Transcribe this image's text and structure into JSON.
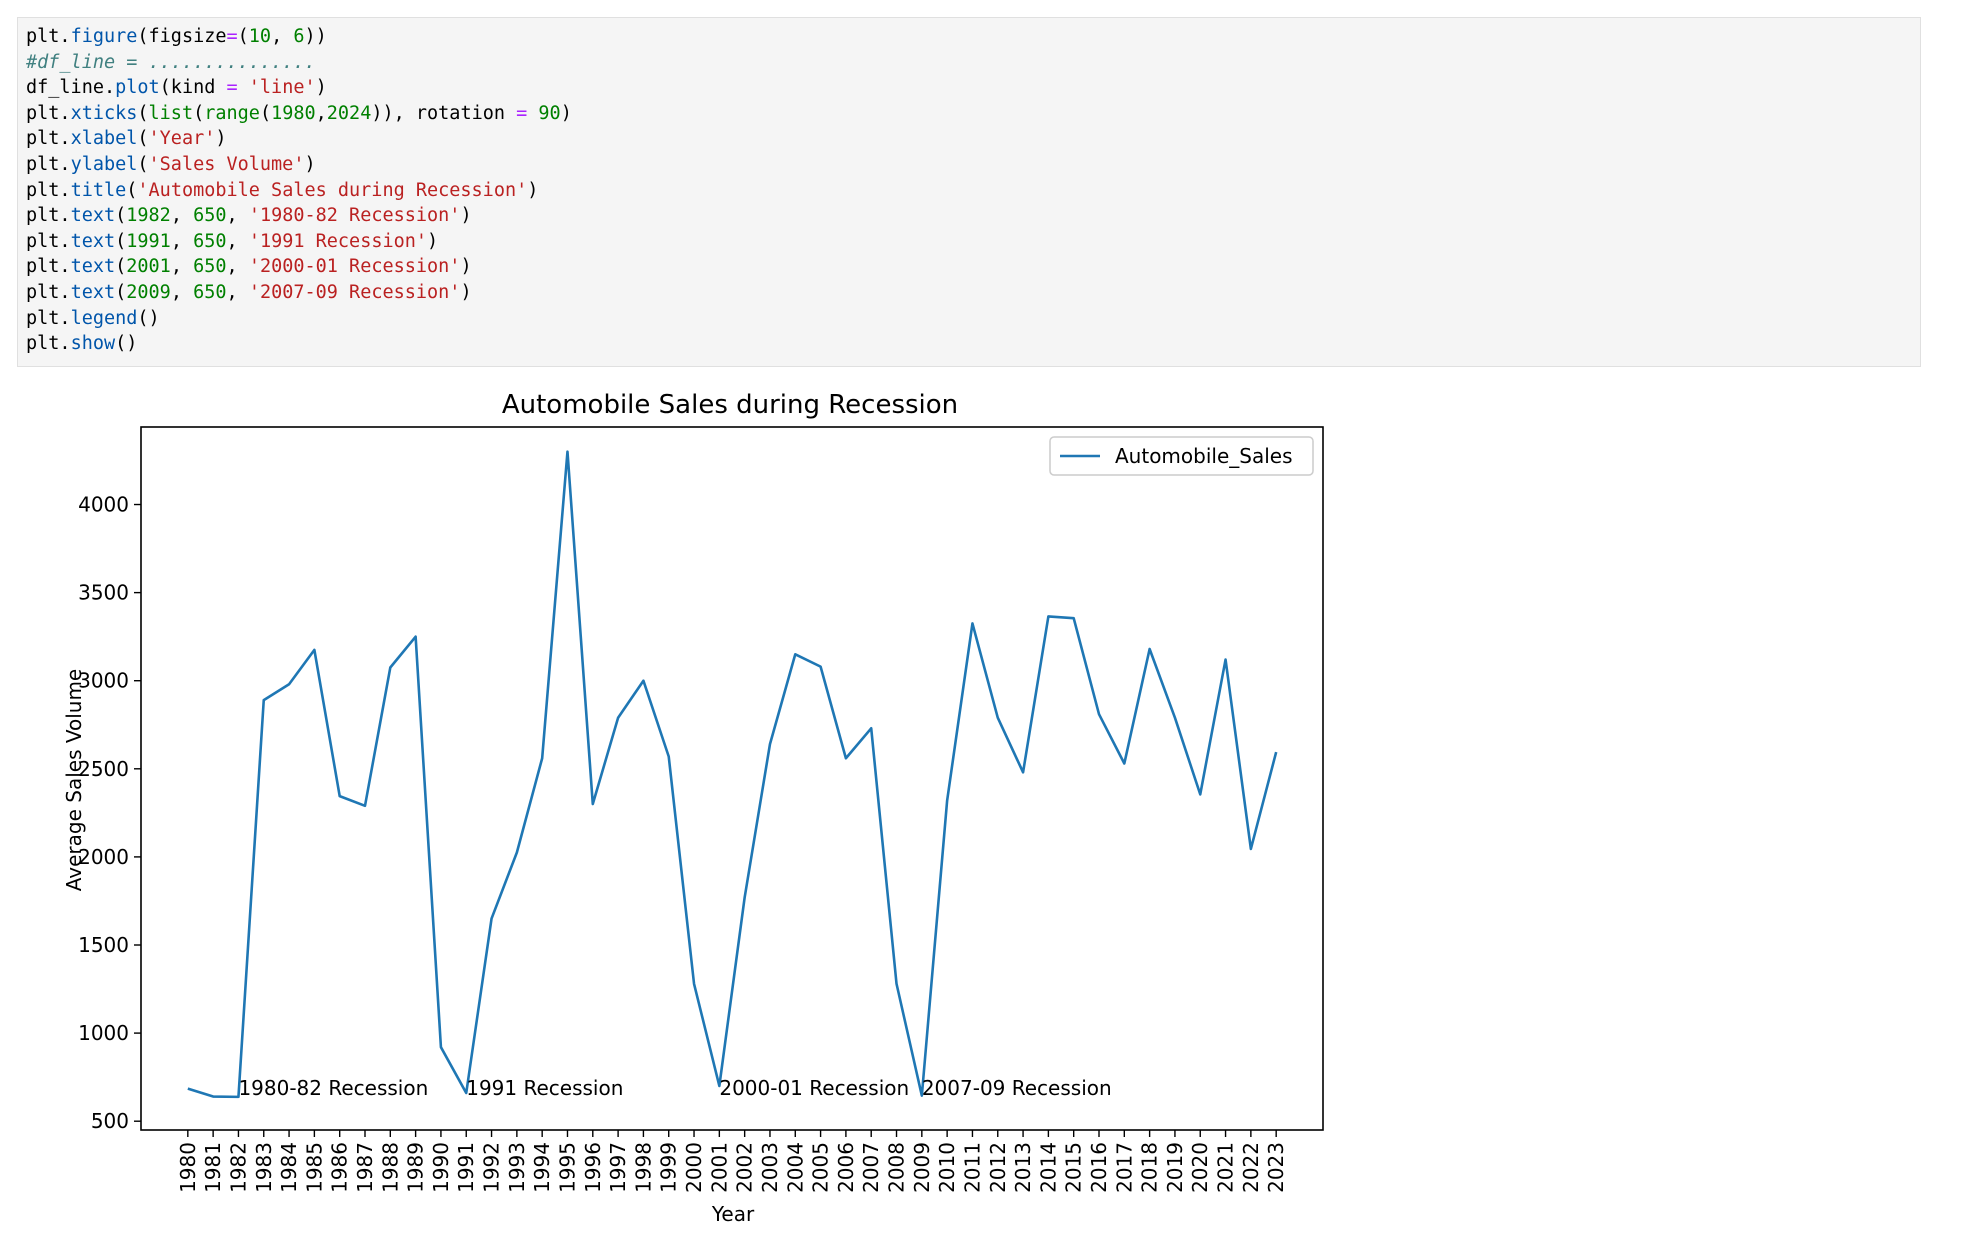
{
  "code_cell": {
    "lines": [
      [
        {
          "t": "plt.",
          "c": "plain"
        },
        {
          "t": "figure",
          "c": "fn"
        },
        {
          "t": "(figsize",
          "c": "plain"
        },
        {
          "t": "=",
          "c": "op"
        },
        {
          "t": "(",
          "c": "plain"
        },
        {
          "t": "10",
          "c": "num"
        },
        {
          "t": ", ",
          "c": "plain"
        },
        {
          "t": "6",
          "c": "num"
        },
        {
          "t": "))",
          "c": "plain"
        }
      ],
      [
        {
          "t": "#df_line = ...............",
          "c": "comment"
        }
      ],
      [
        {
          "t": "df_line.",
          "c": "plain"
        },
        {
          "t": "plot",
          "c": "fn"
        },
        {
          "t": "(kind ",
          "c": "plain"
        },
        {
          "t": "=",
          "c": "op"
        },
        {
          "t": " ",
          "c": "plain"
        },
        {
          "t": "'line'",
          "c": "str"
        },
        {
          "t": ")",
          "c": "plain"
        }
      ],
      [
        {
          "t": "plt.",
          "c": "plain"
        },
        {
          "t": "xticks",
          "c": "fn"
        },
        {
          "t": "(",
          "c": "plain"
        },
        {
          "t": "list",
          "c": "num"
        },
        {
          "t": "(",
          "c": "plain"
        },
        {
          "t": "range",
          "c": "num"
        },
        {
          "t": "(",
          "c": "plain"
        },
        {
          "t": "1980",
          "c": "num"
        },
        {
          "t": ",",
          "c": "plain"
        },
        {
          "t": "2024",
          "c": "num"
        },
        {
          "t": ")), rotation ",
          "c": "plain"
        },
        {
          "t": "=",
          "c": "op"
        },
        {
          "t": " ",
          "c": "plain"
        },
        {
          "t": "90",
          "c": "num"
        },
        {
          "t": ")",
          "c": "plain"
        }
      ],
      [
        {
          "t": "plt.",
          "c": "plain"
        },
        {
          "t": "xlabel",
          "c": "fn"
        },
        {
          "t": "(",
          "c": "plain"
        },
        {
          "t": "'Year'",
          "c": "str"
        },
        {
          "t": ")",
          "c": "plain"
        }
      ],
      [
        {
          "t": "plt.",
          "c": "plain"
        },
        {
          "t": "ylabel",
          "c": "fn"
        },
        {
          "t": "(",
          "c": "plain"
        },
        {
          "t": "'Sales Volume'",
          "c": "str"
        },
        {
          "t": ")",
          "c": "plain"
        }
      ],
      [
        {
          "t": "plt.",
          "c": "plain"
        },
        {
          "t": "title",
          "c": "fn"
        },
        {
          "t": "(",
          "c": "plain"
        },
        {
          "t": "'Automobile Sales during Recession'",
          "c": "str"
        },
        {
          "t": ")",
          "c": "plain"
        }
      ],
      [
        {
          "t": "plt.",
          "c": "plain"
        },
        {
          "t": "text",
          "c": "fn"
        },
        {
          "t": "(",
          "c": "plain"
        },
        {
          "t": "1982",
          "c": "num"
        },
        {
          "t": ", ",
          "c": "plain"
        },
        {
          "t": "650",
          "c": "num"
        },
        {
          "t": ", ",
          "c": "plain"
        },
        {
          "t": "'1980-82 Recession'",
          "c": "str"
        },
        {
          "t": ")",
          "c": "plain"
        }
      ],
      [
        {
          "t": "plt.",
          "c": "plain"
        },
        {
          "t": "text",
          "c": "fn"
        },
        {
          "t": "(",
          "c": "plain"
        },
        {
          "t": "1991",
          "c": "num"
        },
        {
          "t": ", ",
          "c": "plain"
        },
        {
          "t": "650",
          "c": "num"
        },
        {
          "t": ", ",
          "c": "plain"
        },
        {
          "t": "'1991 Recession'",
          "c": "str"
        },
        {
          "t": ")",
          "c": "plain"
        }
      ],
      [
        {
          "t": "plt.",
          "c": "plain"
        },
        {
          "t": "text",
          "c": "fn"
        },
        {
          "t": "(",
          "c": "plain"
        },
        {
          "t": "2001",
          "c": "num"
        },
        {
          "t": ", ",
          "c": "plain"
        },
        {
          "t": "650",
          "c": "num"
        },
        {
          "t": ", ",
          "c": "plain"
        },
        {
          "t": "'2000-01 Recession'",
          "c": "str"
        },
        {
          "t": ")",
          "c": "plain"
        }
      ],
      [
        {
          "t": "plt.",
          "c": "plain"
        },
        {
          "t": "text",
          "c": "fn"
        },
        {
          "t": "(",
          "c": "plain"
        },
        {
          "t": "2009",
          "c": "num"
        },
        {
          "t": ", ",
          "c": "plain"
        },
        {
          "t": "650",
          "c": "num"
        },
        {
          "t": ", ",
          "c": "plain"
        },
        {
          "t": "'2007-09 Recession'",
          "c": "str"
        },
        {
          "t": ")",
          "c": "plain"
        }
      ],
      [
        {
          "t": "plt.",
          "c": "plain"
        },
        {
          "t": "legend",
          "c": "fn"
        },
        {
          "t": "()",
          "c": "plain"
        }
      ],
      [
        {
          "t": "plt.",
          "c": "plain"
        },
        {
          "t": "show",
          "c": "fn"
        },
        {
          "t": "()",
          "c": "plain"
        }
      ]
    ]
  },
  "colors": {
    "code_background": "#f5f5f5",
    "function": "#0055aa",
    "number": "#008000",
    "string": "#ba2121",
    "operator": "#aa22ff",
    "comment": "#408080",
    "line": "#1f77b4"
  },
  "chart_data": {
    "type": "line",
    "title": "Automobile Sales during Recession",
    "xlabel": "Year",
    "ylabel": "Average Sales Volume",
    "x": [
      1980,
      1981,
      1982,
      1983,
      1984,
      1985,
      1986,
      1987,
      1988,
      1989,
      1990,
      1991,
      1992,
      1993,
      1994,
      1995,
      1996,
      1997,
      1998,
      1999,
      2000,
      2001,
      2002,
      2003,
      2004,
      2005,
      2006,
      2007,
      2008,
      2009,
      2010,
      2011,
      2012,
      2013,
      2014,
      2015,
      2016,
      2017,
      2018,
      2019,
      2020,
      2021,
      2022,
      2023
    ],
    "series": [
      {
        "name": "Automobile_Sales",
        "color": "#1f77b4",
        "values": [
          685,
          640,
          638,
          2890,
          2980,
          3175,
          2345,
          2290,
          3075,
          3250,
          920,
          660,
          1650,
          2025,
          2560,
          4300,
          2300,
          2790,
          3000,
          2570,
          1280,
          700,
          1770,
          2640,
          3150,
          3080,
          2560,
          2730,
          1280,
          645,
          2320,
          3325,
          2790,
          2480,
          3365,
          3355,
          2810,
          2530,
          3180,
          2790,
          2355,
          3120,
          2045,
          2595
        ]
      }
    ],
    "xlim": [
      1978.15,
      2024.85
    ],
    "ylim": [
      450,
      4440
    ],
    "yticks": [
      500,
      1000,
      1500,
      2000,
      2500,
      3000,
      3500,
      4000
    ],
    "xtick_rotation": 90,
    "annotations": [
      {
        "x": 1982,
        "y": 650,
        "text": "1980-82 Recession"
      },
      {
        "x": 1991,
        "y": 650,
        "text": "1991 Recession"
      },
      {
        "x": 2001,
        "y": 650,
        "text": "2000-01 Recession"
      },
      {
        "x": 2009,
        "y": 650,
        "text": "2007-09 Recession"
      }
    ],
    "legend_position": "top-right",
    "grid": false
  }
}
